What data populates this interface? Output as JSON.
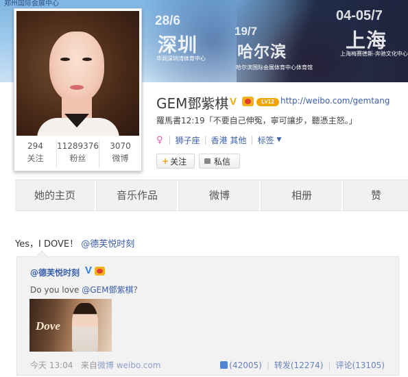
{
  "banner": {
    "brand": "郑州国际会展中心",
    "concerts": [
      {
        "date": "28/6",
        "city": "深圳",
        "venue": "华润深圳湾体育中心"
      },
      {
        "date": "19/7",
        "city": "哈尔滨",
        "venue": "哈尔滨国际会展体育中心体育馆"
      },
      {
        "date": "04-05/7",
        "city": "上海",
        "venue": "上海梅赛德斯-奔驰文化中心"
      }
    ]
  },
  "profile": {
    "name": "GEM鄧紫棋",
    "verified_badge": "V",
    "level": "LV12",
    "link": "http://weibo.com/gemtang",
    "bio": "羅馬書12:19「不要自己伸冤，寧可讓步，聽憑主怒。」",
    "gender_icon": "female-icon",
    "constellation": "狮子座",
    "location": "香港 其他",
    "tags_label": "标签",
    "stats": [
      {
        "value": "294",
        "label": "关注"
      },
      {
        "value": "11289376",
        "label": "粉丝"
      },
      {
        "value": "3070",
        "label": "微博"
      }
    ],
    "follow_label": "关注",
    "message_label": "私信"
  },
  "tabs": [
    "她的主页",
    "音乐作品",
    "微博",
    "相册",
    "赞"
  ],
  "feed": {
    "text": "Yes，I DOVE！",
    "mention": "@德芙悦时刻",
    "repost": {
      "author": "@德芙悦时刻",
      "verified_badge": "V",
      "text_prefix": "Do you love ",
      "text_mention": "@GEM鄧紫棋",
      "text_suffix": "？",
      "image_logo": "Dove",
      "time": "今天 13:04",
      "source_prefix": "来自",
      "source": "微博 weibo.com",
      "likes": "(42005)",
      "reposts": "转发(12274)",
      "comments": "评论(13105)"
    }
  },
  "colors": {
    "link": "#3a5daa",
    "accent": "#f5a623",
    "verified_gold": "#f2a900",
    "verified_blue": "#2f7de1"
  }
}
